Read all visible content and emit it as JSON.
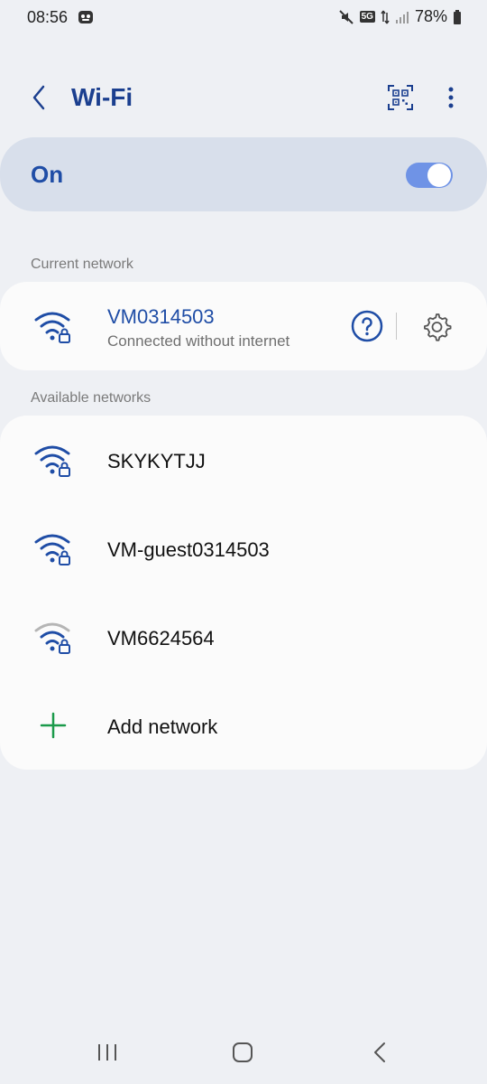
{
  "status_bar": {
    "time": "08:56",
    "network_type": "5G",
    "battery": "78%"
  },
  "header": {
    "title": "Wi-Fi",
    "icons": [
      "back-arrow-icon",
      "qr-code-icon",
      "more-vertical-icon"
    ]
  },
  "toggle": {
    "label": "On",
    "state": true,
    "accent_color": "#6f93e6"
  },
  "sections": {
    "current_label": "Current network",
    "available_label": "Available networks"
  },
  "current_network": {
    "name": "VM0314503",
    "status": "Connected without internet",
    "icon": "wifi-lock-icon",
    "signal": "full",
    "color": "#1f4da6"
  },
  "available_networks": [
    {
      "name": "SKYKYTJJ",
      "icon": "wifi-lock-icon",
      "signal": "full"
    },
    {
      "name": "VM-guest0314503",
      "icon": "wifi-lock-icon",
      "signal": "full"
    },
    {
      "name": "VM6624564",
      "icon": "wifi-lock-icon",
      "signal": "medium"
    }
  ],
  "add_network": {
    "label": "Add network",
    "icon": "plus-icon",
    "color": "#1a9a4a"
  },
  "nav_bar": {
    "icons": [
      "recent-apps-icon",
      "home-icon",
      "back-icon"
    ]
  }
}
